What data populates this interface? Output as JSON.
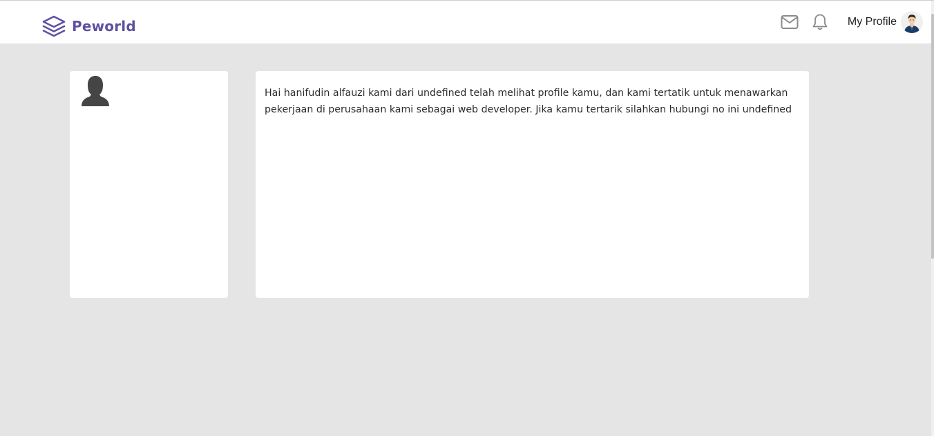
{
  "navbar": {
    "brand": "Peworld",
    "brand_color": "#5e50a1",
    "icons": [
      "mail-icon",
      "bell-icon"
    ],
    "profile_label": "My Profile"
  },
  "sidebar_card": {
    "photo_icon": "user-silhouette-icon"
  },
  "message_card": {
    "text": "Hai hanifudin alfauzi kami dari undefined telah melihat profile kamu, dan kami tertatik untuk menawarkan pekerjaan di perusahaan kami sebagai web developer. Jika kamu tertarik silahkan hubungi no ini undefined"
  }
}
